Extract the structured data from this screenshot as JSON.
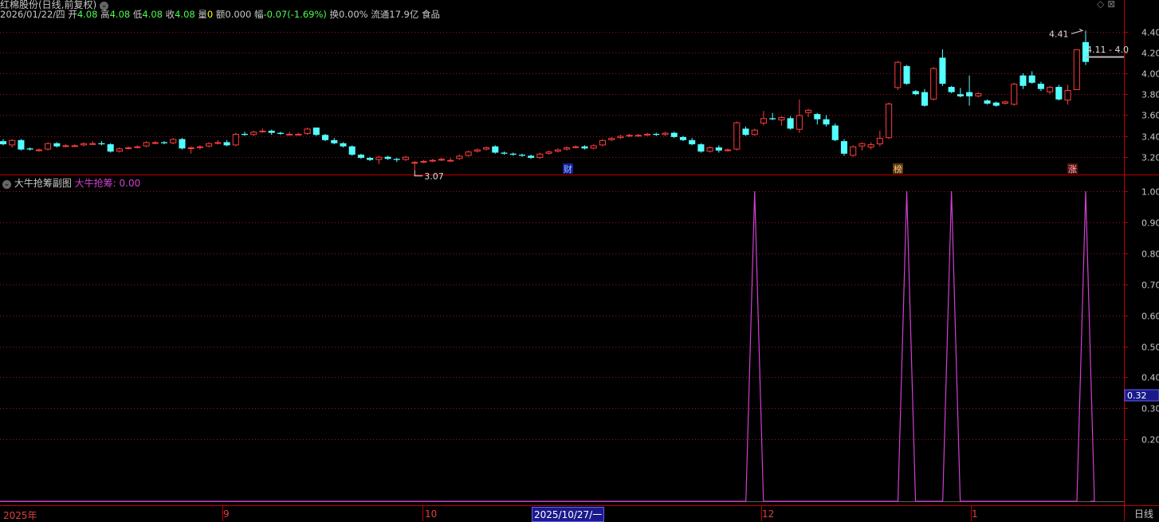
{
  "header": {
    "stock_title": "红棉股份(日线,前复权)",
    "date": "2026/01/22/四",
    "open_label": "开",
    "open": "4.08",
    "high_label": "高",
    "high": "4.08",
    "low_label": "低",
    "low": "4.08",
    "close_label": "收",
    "close": "4.08",
    "volume_label": "量",
    "volume": "0",
    "amount_label": "额",
    "amount": "0.000",
    "change_label": "幅",
    "change": "-0.07(-1.69%)",
    "turnover_label": "换",
    "turnover": "0.00%",
    "float_label": "流通",
    "float": "17.9亿",
    "sector": "食品"
  },
  "sub_panel": {
    "title": "大牛抢筹副图",
    "indicator_label": "大牛抢筹:",
    "indicator_value": "0.00"
  },
  "annotations": {
    "high_marker": "4.41",
    "low_marker": "3.07",
    "price_range_tag": "4.11 - 4.0",
    "crosshair_value": "0.32",
    "event_badges": [
      "财",
      "榜",
      "涨"
    ]
  },
  "x_axis": {
    "labels": [
      "2025年",
      "9",
      "10",
      "2025/10/27/一",
      "12",
      "1"
    ],
    "period_tab": "日线"
  },
  "colors": {
    "up": "#ff3c3c",
    "down": "#54ffff",
    "indicator": "#d040d0",
    "grid": "#8b1a1a",
    "axis": "#c00000"
  },
  "chart_data": [
    {
      "type": "candlestick",
      "title": "红棉股份(日线,前复权)",
      "y_ticks": [
        3.2,
        3.4,
        3.6,
        3.8,
        4.0,
        4.2,
        4.4
      ],
      "ylim": [
        3.03,
        4.52
      ],
      "ohlc": [
        [
          3.35,
          3.37,
          3.31,
          3.32
        ],
        [
          3.31,
          3.37,
          3.29,
          3.36
        ],
        [
          3.36,
          3.37,
          3.26,
          3.27
        ],
        [
          3.28,
          3.29,
          3.26,
          3.27
        ],
        [
          3.26,
          3.28,
          3.25,
          3.27
        ],
        [
          3.27,
          3.34,
          3.26,
          3.33
        ],
        [
          3.33,
          3.34,
          3.29,
          3.3
        ],
        [
          3.3,
          3.32,
          3.29,
          3.31
        ],
        [
          3.31,
          3.32,
          3.3,
          3.31
        ],
        [
          3.31,
          3.34,
          3.3,
          3.33
        ],
        [
          3.33,
          3.35,
          3.32,
          3.33
        ],
        [
          3.33,
          3.35,
          3.31,
          3.32
        ],
        [
          3.32,
          3.33,
          3.24,
          3.25
        ],
        [
          3.25,
          3.29,
          3.24,
          3.28
        ],
        [
          3.28,
          3.3,
          3.27,
          3.29
        ],
        [
          3.29,
          3.31,
          3.28,
          3.3
        ],
        [
          3.3,
          3.35,
          3.29,
          3.34
        ],
        [
          3.34,
          3.35,
          3.32,
          3.34
        ],
        [
          3.34,
          3.35,
          3.32,
          3.33
        ],
        [
          3.33,
          3.38,
          3.32,
          3.37
        ],
        [
          3.37,
          3.38,
          3.27,
          3.28
        ],
        [
          3.28,
          3.3,
          3.23,
          3.29
        ],
        [
          3.29,
          3.31,
          3.27,
          3.3
        ],
        [
          3.3,
          3.34,
          3.29,
          3.33
        ],
        [
          3.33,
          3.36,
          3.32,
          3.34
        ],
        [
          3.34,
          3.36,
          3.3,
          3.31
        ],
        [
          3.31,
          3.43,
          3.3,
          3.42
        ],
        [
          3.42,
          3.44,
          3.4,
          3.41
        ],
        [
          3.41,
          3.45,
          3.4,
          3.44
        ],
        [
          3.44,
          3.47,
          3.43,
          3.45
        ],
        [
          3.45,
          3.46,
          3.41,
          3.43
        ],
        [
          3.43,
          3.44,
          3.41,
          3.42
        ],
        [
          3.42,
          3.44,
          3.41,
          3.42
        ],
        [
          3.42,
          3.43,
          3.41,
          3.42
        ],
        [
          3.42,
          3.48,
          3.41,
          3.47
        ],
        [
          3.48,
          3.48,
          3.4,
          3.41
        ],
        [
          3.41,
          3.42,
          3.35,
          3.36
        ],
        [
          3.36,
          3.38,
          3.32,
          3.33
        ],
        [
          3.33,
          3.34,
          3.29,
          3.3
        ],
        [
          3.3,
          3.31,
          3.21,
          3.22
        ],
        [
          3.22,
          3.23,
          3.18,
          3.19
        ],
        [
          3.19,
          3.2,
          3.16,
          3.17
        ],
        [
          3.17,
          3.21,
          3.13,
          3.2
        ],
        [
          3.2,
          3.21,
          3.17,
          3.18
        ],
        [
          3.18,
          3.19,
          3.15,
          3.17
        ],
        [
          3.17,
          3.21,
          3.16,
          3.2
        ],
        [
          3.14,
          3.16,
          3.07,
          3.15
        ],
        [
          3.15,
          3.17,
          3.14,
          3.16
        ],
        [
          3.16,
          3.18,
          3.15,
          3.17
        ],
        [
          3.17,
          3.19,
          3.16,
          3.18
        ],
        [
          3.17,
          3.19,
          3.15,
          3.17
        ],
        [
          3.18,
          3.22,
          3.17,
          3.21
        ],
        [
          3.21,
          3.26,
          3.2,
          3.25
        ],
        [
          3.25,
          3.28,
          3.24,
          3.27
        ],
        [
          3.27,
          3.3,
          3.26,
          3.29
        ],
        [
          3.3,
          3.31,
          3.23,
          3.24
        ],
        [
          3.24,
          3.25,
          3.22,
          3.23
        ],
        [
          3.23,
          3.24,
          3.21,
          3.22
        ],
        [
          3.22,
          3.23,
          3.2,
          3.21
        ],
        [
          3.21,
          3.22,
          3.18,
          3.19
        ],
        [
          3.19,
          3.24,
          3.18,
          3.23
        ],
        [
          3.23,
          3.26,
          3.22,
          3.25
        ],
        [
          3.25,
          3.28,
          3.24,
          3.27
        ],
        [
          3.27,
          3.3,
          3.26,
          3.29
        ],
        [
          3.29,
          3.31,
          3.28,
          3.3
        ],
        [
          3.3,
          3.31,
          3.27,
          3.28
        ],
        [
          3.28,
          3.32,
          3.27,
          3.31
        ],
        [
          3.31,
          3.37,
          3.3,
          3.36
        ],
        [
          3.36,
          3.39,
          3.35,
          3.38
        ],
        [
          3.38,
          3.41,
          3.37,
          3.4
        ],
        [
          3.4,
          3.42,
          3.39,
          3.41
        ],
        [
          3.41,
          3.42,
          3.4,
          3.41
        ],
        [
          3.41,
          3.43,
          3.4,
          3.42
        ],
        [
          3.42,
          3.43,
          3.4,
          3.41
        ],
        [
          3.41,
          3.44,
          3.4,
          3.43
        ],
        [
          3.43,
          3.44,
          3.38,
          3.39
        ],
        [
          3.39,
          3.4,
          3.35,
          3.36
        ],
        [
          3.36,
          3.38,
          3.31,
          3.32
        ],
        [
          3.32,
          3.33,
          3.24,
          3.25
        ],
        [
          3.25,
          3.3,
          3.24,
          3.29
        ],
        [
          3.29,
          3.31,
          3.24,
          3.26
        ],
        [
          3.26,
          3.28,
          3.25,
          3.27
        ],
        [
          3.27,
          3.54,
          3.26,
          3.53
        ],
        [
          3.47,
          3.49,
          3.4,
          3.41
        ],
        [
          3.41,
          3.47,
          3.4,
          3.46
        ],
        [
          3.52,
          3.64,
          3.5,
          3.57
        ],
        [
          3.57,
          3.62,
          3.55,
          3.56
        ],
        [
          3.55,
          3.59,
          3.5,
          3.58
        ],
        [
          3.57,
          3.59,
          3.46,
          3.47
        ],
        [
          3.46,
          3.75,
          3.43,
          3.6
        ],
        [
          3.62,
          3.66,
          3.58,
          3.65
        ],
        [
          3.61,
          3.62,
          3.51,
          3.56
        ],
        [
          3.56,
          3.6,
          3.49,
          3.51
        ],
        [
          3.5,
          3.52,
          3.35,
          3.36
        ],
        [
          3.35,
          3.37,
          3.21,
          3.23
        ],
        [
          3.21,
          3.31,
          3.2,
          3.3
        ],
        [
          3.3,
          3.34,
          3.26,
          3.33
        ],
        [
          3.29,
          3.34,
          3.27,
          3.32
        ],
        [
          3.32,
          3.45,
          3.3,
          3.38
        ],
        [
          3.38,
          3.72,
          3.37,
          3.71
        ],
        [
          3.86,
          4.12,
          3.84,
          4.11
        ],
        [
          4.07,
          4.08,
          3.89,
          3.9
        ],
        [
          3.83,
          3.84,
          3.79,
          3.8
        ],
        [
          3.82,
          3.85,
          3.68,
          3.69
        ],
        [
          3.75,
          4.06,
          3.74,
          4.05
        ],
        [
          4.15,
          4.23,
          3.88,
          3.9
        ],
        [
          3.87,
          3.88,
          3.81,
          3.82
        ],
        [
          3.8,
          3.86,
          3.77,
          3.78
        ],
        [
          3.82,
          3.98,
          3.69,
          3.78
        ],
        [
          3.78,
          3.82,
          3.77,
          3.81
        ],
        [
          3.74,
          3.75,
          3.7,
          3.71
        ],
        [
          3.72,
          3.73,
          3.68,
          3.69
        ],
        [
          3.71,
          3.74,
          3.7,
          3.73
        ],
        [
          3.7,
          3.91,
          3.69,
          3.9
        ],
        [
          3.98,
          4.0,
          3.85,
          3.88
        ],
        [
          3.98,
          4.02,
          3.9,
          3.91
        ],
        [
          3.9,
          3.92,
          3.83,
          3.85
        ],
        [
          3.82,
          3.88,
          3.8,
          3.87
        ],
        [
          3.87,
          3.89,
          3.74,
          3.75
        ],
        [
          3.74,
          3.89,
          3.7,
          3.84
        ],
        [
          3.84,
          4.23,
          3.84,
          4.23
        ],
        [
          4.3,
          4.41,
          4.08,
          4.11
        ]
      ],
      "markers": [
        {
          "label": "4.41",
          "kind": "high"
        },
        {
          "label": "3.07",
          "kind": "low"
        }
      ]
    },
    {
      "type": "line",
      "title": "大牛抢筹副图",
      "series": [
        {
          "name": "大牛抢筹",
          "values_note": "",
          "peaks_at_bar": [
            84,
            101,
            106,
            121
          ],
          "peak_value": 1.0,
          "base_value": 0.0
        }
      ],
      "y_ticks": [
        0.2,
        0.3,
        0.4,
        0.5,
        0.6,
        0.7,
        0.8,
        0.9,
        1.0
      ],
      "ylim": [
        0,
        1.0
      ]
    }
  ]
}
